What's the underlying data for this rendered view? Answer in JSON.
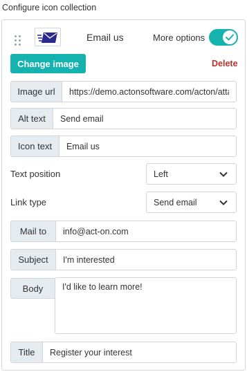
{
  "panel": {
    "title": "Configure icon collection"
  },
  "item": {
    "name": "Email us",
    "more_options_label": "More options",
    "more_options_enabled": true,
    "thumbnail_icon": "email-envelope-icon"
  },
  "actions": {
    "change_image_label": "Change image",
    "delete_label": "Delete"
  },
  "fields": {
    "image_url": {
      "label": "Image url",
      "value": "https://demo.actonsoftware.com/acton/attachment/"
    },
    "alt_text": {
      "label": "Alt text",
      "value": "Send email"
    },
    "icon_text": {
      "label": "Icon text",
      "value": "Email us"
    },
    "text_position": {
      "label": "Text position",
      "value": "Left"
    },
    "link_type": {
      "label": "Link type",
      "value": "Send email"
    },
    "mail_to": {
      "label": "Mail to",
      "value": "info@act-on.com"
    },
    "subject": {
      "label": "Subject",
      "value": "I'm interested"
    },
    "body": {
      "label": "Body",
      "value": "I'd like to learn more!"
    },
    "title": {
      "label": "Title",
      "value": "Register your interest"
    }
  },
  "colors": {
    "accent": "#14b3b0",
    "danger": "#b7312c",
    "label_bg": "#e6ebf0",
    "border": "#cfd5db"
  }
}
